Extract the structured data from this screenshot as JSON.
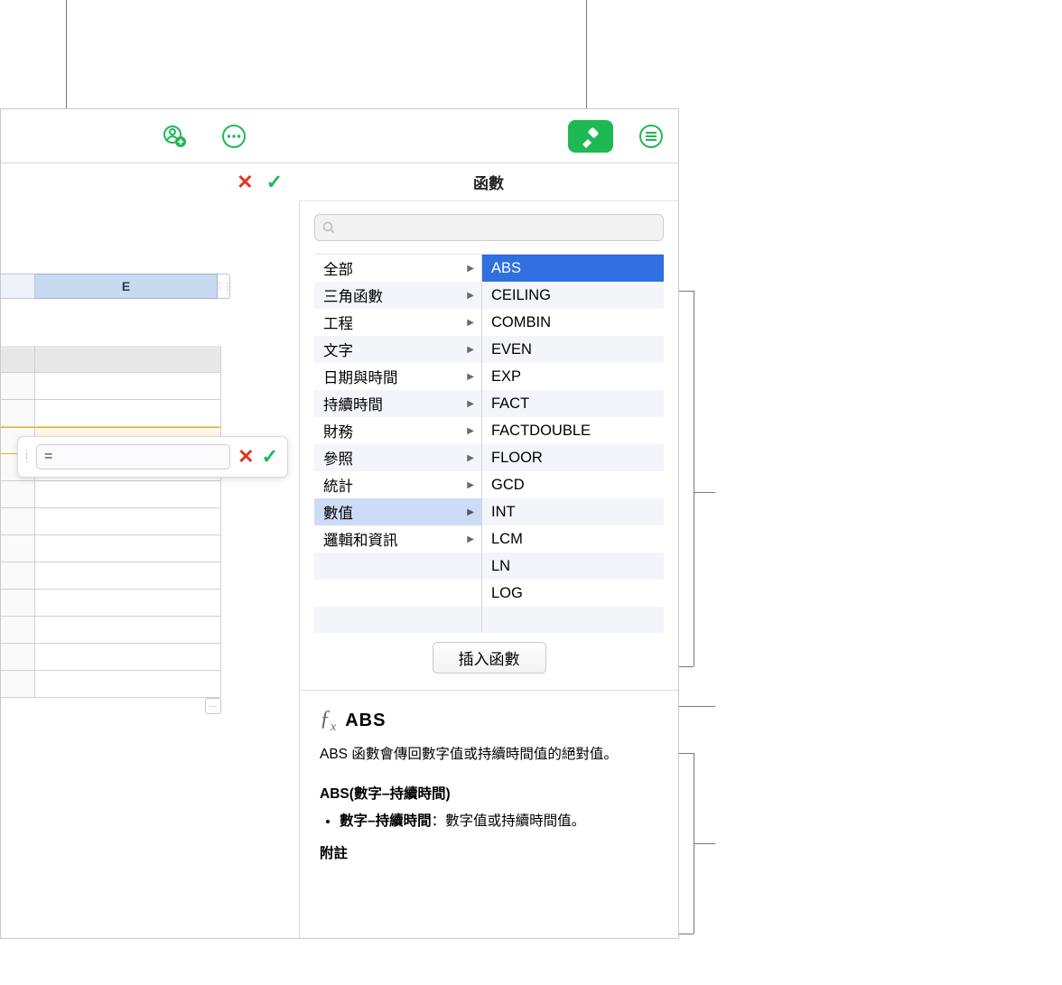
{
  "toolbar": {
    "collab_icon": "collaborate-icon",
    "more_icon": "more-icon",
    "format_icon": "format-brush-icon",
    "menu_icon": "doc-menu-icon"
  },
  "panel": {
    "title": "函數",
    "search_placeholder": ""
  },
  "categories": [
    "全部",
    "三角函數",
    "工程",
    "文字",
    "日期與時間",
    "持續時間",
    "財務",
    "參照",
    "統計",
    "數值",
    "邏輯和資訊"
  ],
  "selected_category_index": 9,
  "functions": [
    "ABS",
    "CEILING",
    "COMBIN",
    "EVEN",
    "EXP",
    "FACT",
    "FACTDOUBLE",
    "FLOOR",
    "GCD",
    "INT",
    "LCM",
    "LN",
    "LOG"
  ],
  "selected_function_index": 0,
  "insert_button_label": "插入函數",
  "help": {
    "title": "ABS",
    "description": "ABS 函數會傳回數字值或持續時間值的絕對值。",
    "syntax": "ABS(數字–持續時間)",
    "arg_name": "數字–持續時間",
    "arg_desc": "：數字值或持續時間值。",
    "notes_heading": "附註"
  },
  "sheet": {
    "column_label": "E",
    "formula_prefix": "="
  }
}
